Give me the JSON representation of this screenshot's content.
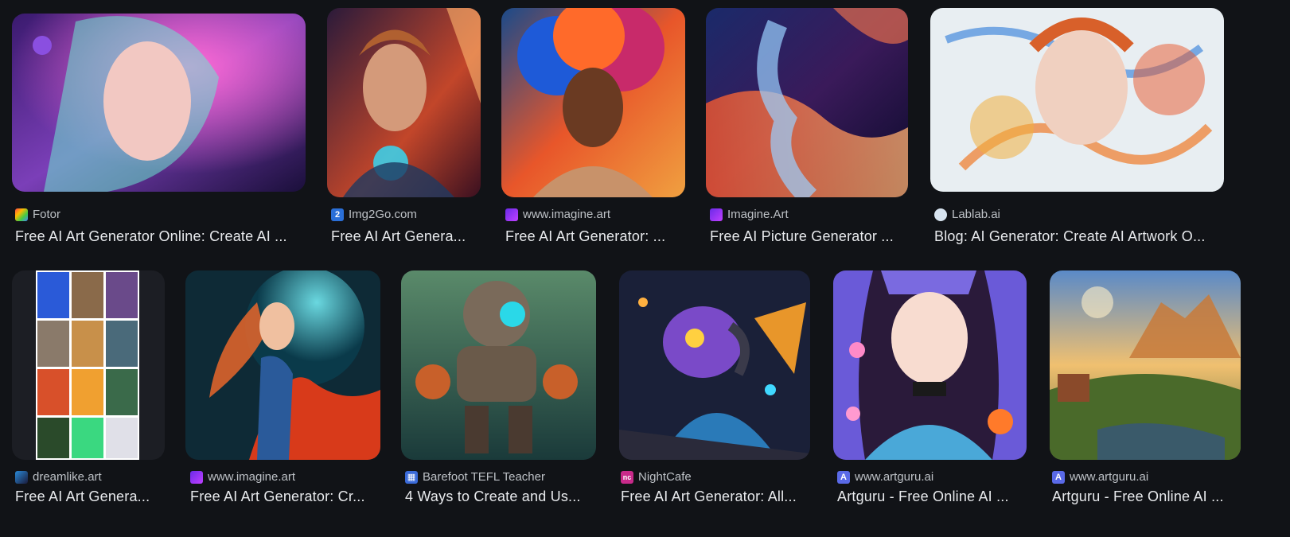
{
  "results": [
    {
      "source": "Fotor",
      "title": "Free AI Art Generator Online: Create AI ...",
      "favicon": "fotor-icon"
    },
    {
      "source": "Img2Go.com",
      "title": "Free AI Art Genera...",
      "favicon": "img2go-icon"
    },
    {
      "source": "www.imagine.art",
      "title": "Free AI Art Generator: ...",
      "favicon": "imagine-icon"
    },
    {
      "source": "Imagine.Art",
      "title": "Free AI Picture Generator ...",
      "favicon": "imagine-icon"
    },
    {
      "source": "Lablab.ai",
      "title": "Blog: AI Generator: Create AI Artwork O...",
      "favicon": "lablab-icon"
    },
    {
      "source": "dreamlike.art",
      "title": "Free AI Art Genera...",
      "favicon": "dreamlike-icon"
    },
    {
      "source": "www.imagine.art",
      "title": "Free AI Art Generator: Cr...",
      "favicon": "imagine-icon"
    },
    {
      "source": "Barefoot TEFL Teacher",
      "title": "4 Ways to Create and Us...",
      "favicon": "barefoot-icon"
    },
    {
      "source": "NightCafe",
      "title": "Free AI Art Generator: All...",
      "favicon": "nightcafe-icon"
    },
    {
      "source": "www.artguru.ai",
      "title": "Artguru - Free Online AI ...",
      "favicon": "artguru-icon"
    },
    {
      "source": "www.artguru.ai",
      "title": "Artguru - Free Online AI ...",
      "favicon": "artguru-icon"
    }
  ]
}
